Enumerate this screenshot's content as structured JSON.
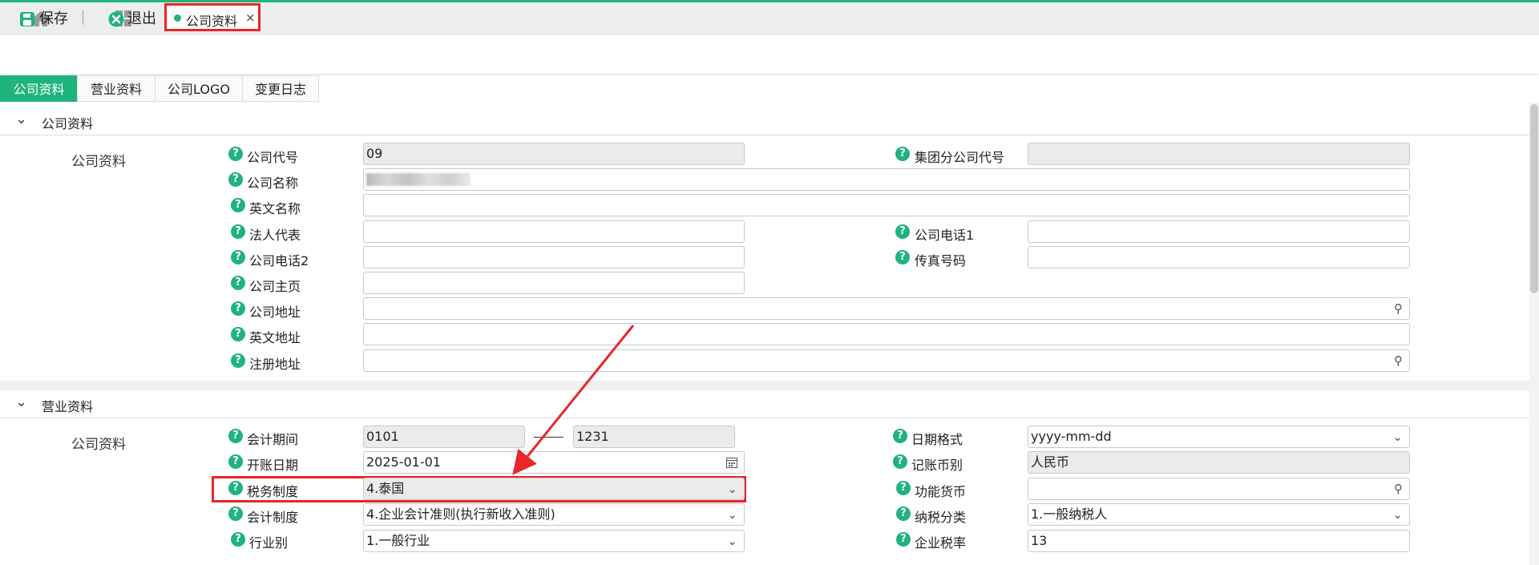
{
  "doc_tab": {
    "label": "公司资料",
    "close": "×"
  },
  "toolbar": {
    "save": "保存",
    "exit": "退出"
  },
  "subtabs": [
    "公司资料",
    "营业资料",
    "公司LOGO",
    "变更日志"
  ],
  "sections": {
    "company": {
      "title": "公司资料",
      "group": "公司资料"
    },
    "business": {
      "title": "营业资料",
      "group": "公司资料"
    }
  },
  "fields": {
    "company_code": {
      "label": "公司代号",
      "value": "09"
    },
    "group_code": {
      "label": "集团分公司代号",
      "value": ""
    },
    "company_name": {
      "label": "公司名称",
      "value": ""
    },
    "english_name": {
      "label": "英文名称",
      "value": ""
    },
    "legal_rep": {
      "label": "法人代表",
      "value": ""
    },
    "phone1": {
      "label": "公司电话1",
      "value": ""
    },
    "phone2": {
      "label": "公司电话2",
      "value": ""
    },
    "fax": {
      "label": "传真号码",
      "value": ""
    },
    "homepage": {
      "label": "公司主页",
      "value": ""
    },
    "address": {
      "label": "公司地址",
      "value": ""
    },
    "english_address": {
      "label": "英文地址",
      "value": ""
    },
    "registered_address": {
      "label": "注册地址",
      "value": ""
    },
    "accounting_period": {
      "label": "会计期间",
      "from": "0101",
      "to": "1231"
    },
    "date_format": {
      "label": "日期格式",
      "value": "yyyy-mm-dd"
    },
    "opening_date": {
      "label": "开账日期",
      "value": "2025-01-01"
    },
    "book_currency": {
      "label": "记账币别",
      "value": "人民币"
    },
    "tax_system": {
      "label": "税务制度",
      "value": "4.泰国"
    },
    "functional_currency": {
      "label": "功能货币",
      "value": ""
    },
    "accounting_system": {
      "label": "会计制度",
      "value": "4.企业会计准则(执行新收入准则)"
    },
    "taxpayer_type": {
      "label": "纳税分类",
      "value": "1.一般纳税人"
    },
    "industry": {
      "label": "行业别",
      "value": "1.一般行业"
    },
    "corp_tax_rate": {
      "label": "企业税率",
      "value": "13"
    }
  },
  "colors": {
    "accent": "#1fb37e",
    "highlight": "#e8262b"
  }
}
